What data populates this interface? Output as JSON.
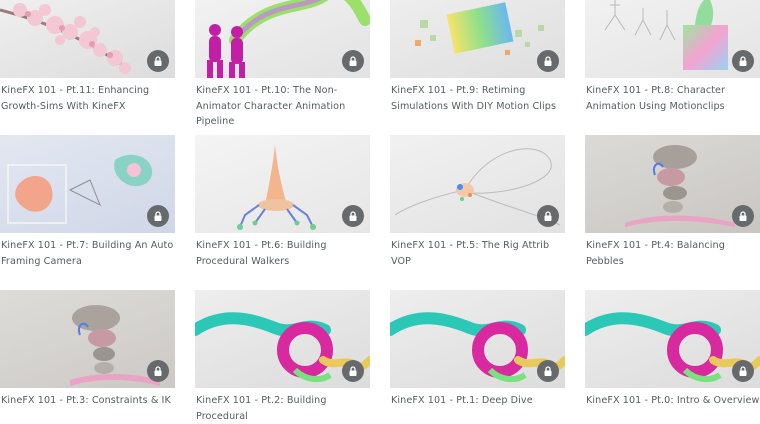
{
  "courses": [
    {
      "title": "KineFX 101 - Pt.11: Enhancing Growth-Sims With KineFX",
      "thumb": "cherry-blossom-branch",
      "locked": true
    },
    {
      "title": "KineFX 101 - Pt.10: The Non-Animator Character Animation Pipeline",
      "thumb": "magenta-characters-neon-worm",
      "locked": true
    },
    {
      "title": "KineFX 101 - Pt.9: Retiming Simulations With DIY Motion Clips",
      "thumb": "rainbow-cubes-shattering",
      "locked": true
    },
    {
      "title": "KineFX 101 - Pt.8: Character Animation Using Motionclips",
      "thumb": "wireframe-figures-gradient-box",
      "locked": true
    },
    {
      "title": "KineFX 101 - Pt.7: Building An Auto Framing Camera",
      "thumb": "camera-frame-blob",
      "locked": true
    },
    {
      "title": "KineFX 101 - Pt.6: Building Procedural Walkers",
      "thumb": "cone-walker-creature",
      "locked": true
    },
    {
      "title": "KineFX 101 - Pt.5: The Rig Attrib VOP",
      "thumb": "curves-rig",
      "locked": true
    },
    {
      "title": "KineFX 101 - Pt.4: Balancing Pebbles",
      "thumb": "stacked-pebbles",
      "locked": true
    },
    {
      "title": "KineFX 101 - Pt.3: Constraints & IK",
      "thumb": "stacked-pebbles",
      "locked": true
    },
    {
      "title": "KineFX 101 - Pt.2: Building Procedural",
      "thumb": "colorful-ribbon-ring",
      "locked": true
    },
    {
      "title": "KineFX 101 - Pt.1: Deep Dive",
      "thumb": "colorful-ribbon-ring",
      "locked": true
    },
    {
      "title": "KineFX 101 - Pt.0: Intro & Overview",
      "thumb": "colorful-ribbon-ring",
      "locked": true
    }
  ],
  "icons": {
    "lock": "lock-icon"
  },
  "colors": {
    "title_text": "#555d60",
    "lock_badge": "#666a6c"
  }
}
